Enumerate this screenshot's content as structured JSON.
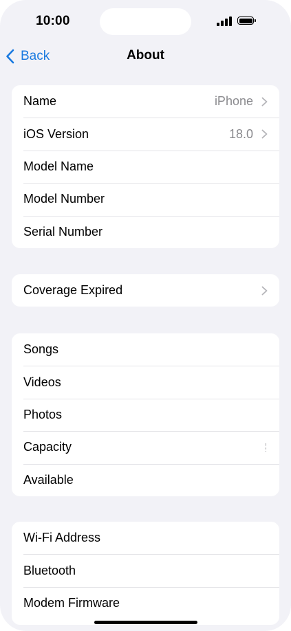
{
  "status_bar": {
    "time": "10:00"
  },
  "nav": {
    "back_label": "Back",
    "title": "About"
  },
  "group1": [
    {
      "label": "Name",
      "value": "iPhone"
    },
    {
      "label": "iOS Version",
      "value": "18.0"
    },
    {
      "label": "Model Name"
    },
    {
      "label": "Model Number"
    },
    {
      "label": "Serial Number"
    }
  ],
  "group2": [
    {
      "label": "Coverage Expired"
    }
  ],
  "group3": [
    {
      "label": "Songs"
    },
    {
      "label": "Videos"
    },
    {
      "label": "Photos"
    },
    {
      "label": "Capacity"
    },
    {
      "label": "Available"
    }
  ],
  "group4": [
    {
      "label": "Wi-Fi Address"
    },
    {
      "label": "Bluetooth"
    },
    {
      "label": "Modem Firmware"
    }
  ],
  "colors": {
    "background": "#f2f2f7",
    "accent": "#1a7ae0",
    "secondary_text": "#8a8a8e",
    "separator": "#e3e3e7"
  }
}
